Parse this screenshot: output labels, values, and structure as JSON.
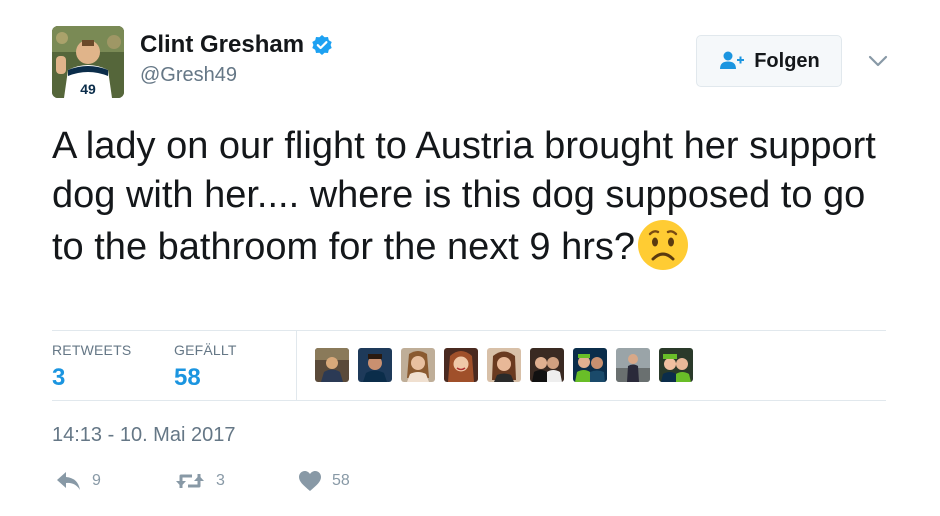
{
  "user": {
    "display_name": "Clint Gresham",
    "handle": "@Gresh49",
    "verified_icon": "verified-badge-icon",
    "avatar_jersey": "49"
  },
  "follow_button": {
    "label": "Folgen",
    "icon": "add-user-icon"
  },
  "menu": {
    "icon": "chevron-down-icon"
  },
  "tweet": {
    "text": "A lady on our flight to Austria brought her support dog with her.... where is this dog supposed to go to the bathroom for the next 9 hrs?",
    "emoji": "worried-face-emoji"
  },
  "stats": {
    "retweets_label": "RETWEETS",
    "retweets_value": "3",
    "likes_label": "GEFÄLLT",
    "likes_value": "58"
  },
  "likers": {
    "count_shown": 9
  },
  "timestamp": "14:13 - 10. Mai 2017",
  "actions": {
    "reply": {
      "icon": "reply-icon",
      "count": "9"
    },
    "retweet": {
      "icon": "retweet-icon",
      "count": "3"
    },
    "like": {
      "icon": "heart-icon",
      "count": "58"
    }
  },
  "colors": {
    "accent": "#1b95e0",
    "verified": "#1da1f2",
    "text": "#14171a",
    "secondary": "#657786",
    "border": "#e1e8ed"
  }
}
